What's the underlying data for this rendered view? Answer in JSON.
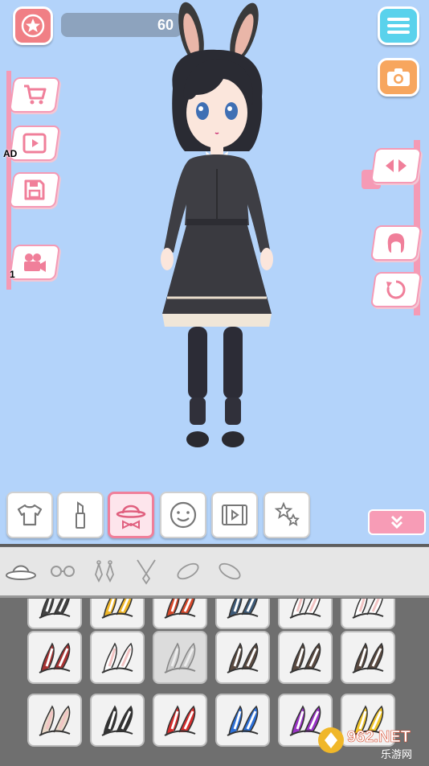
{
  "topbar": {
    "coins": "60"
  },
  "left_menu": {
    "ad_label": "AD",
    "video_count": "1"
  },
  "category_tabs": [
    "clothes",
    "makeup",
    "accessories",
    "face",
    "video",
    "stickers"
  ],
  "sub_tabs": [
    "hat",
    "glasses",
    "earrings",
    "necklace",
    "bracelet",
    "bracelet-alt"
  ],
  "items": {
    "row1_colors": [
      "#444444",
      "#f0b729",
      "#d8482a",
      "#3d5a78",
      "#ffffff",
      "#ffffff"
    ],
    "row2_colors": [
      "#a83232",
      "#ffffff",
      "#bbbbbb",
      "#5a4a40",
      "#5a4a40",
      "#5a4a40"
    ],
    "row3_colors": [
      "#e9d8c8",
      "#333333",
      "#d62c2c",
      "#2c6fd6",
      "#9a33c5",
      "#f0c529"
    ]
  },
  "watermark": {
    "brand": "962.NET",
    "sub": "乐游网"
  },
  "colors": {
    "background": "#b3d3fa",
    "accent_pink": "#f59ab5",
    "panel_gray": "#6f6f6f"
  }
}
